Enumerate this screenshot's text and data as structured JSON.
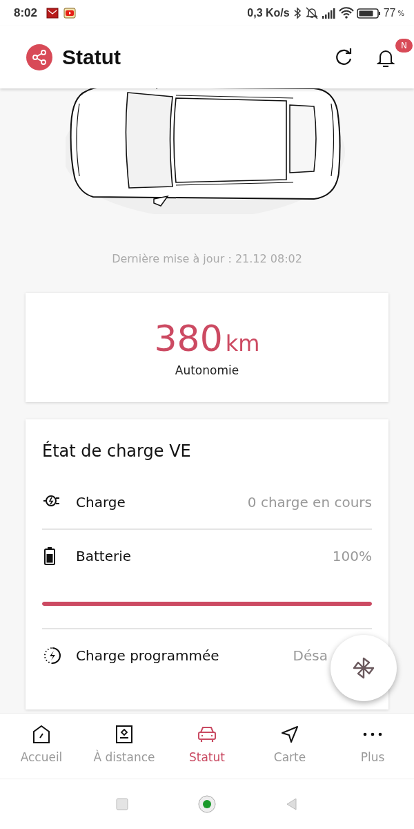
{
  "status_bar": {
    "time": "8:02",
    "notifications": [
      {
        "kind": "mail"
      },
      {
        "kind": "video"
      }
    ],
    "speed": "0,3 Ko/s",
    "battery": "77",
    "battery_unit": "%"
  },
  "header": {
    "title": "Statut",
    "badge": "N"
  },
  "vehicle": {
    "last_update": "Dernière mise à jour : 21.12 08:02"
  },
  "range": {
    "value": "380",
    "unit": "km",
    "label": "Autonomie"
  },
  "charge_card": {
    "title": "État de charge VE",
    "rows": [
      {
        "kind": "plug",
        "label": "Charge",
        "value": "0 charge en cours"
      },
      {
        "kind": "battery",
        "label": "Batterie",
        "value": "100%",
        "level": 1.0
      },
      {
        "kind": "timer",
        "label": "Charge programmée",
        "value": "Désa"
      }
    ]
  },
  "bottom_nav": [
    {
      "kind": "home",
      "label": "Accueil",
      "selected": false
    },
    {
      "kind": "remote",
      "label": "À distance",
      "selected": false
    },
    {
      "kind": "car",
      "label": "Statut",
      "selected": true
    },
    {
      "kind": "map",
      "label": "Carte",
      "selected": false
    },
    {
      "kind": "more",
      "label": "Plus",
      "selected": false
    }
  ]
}
